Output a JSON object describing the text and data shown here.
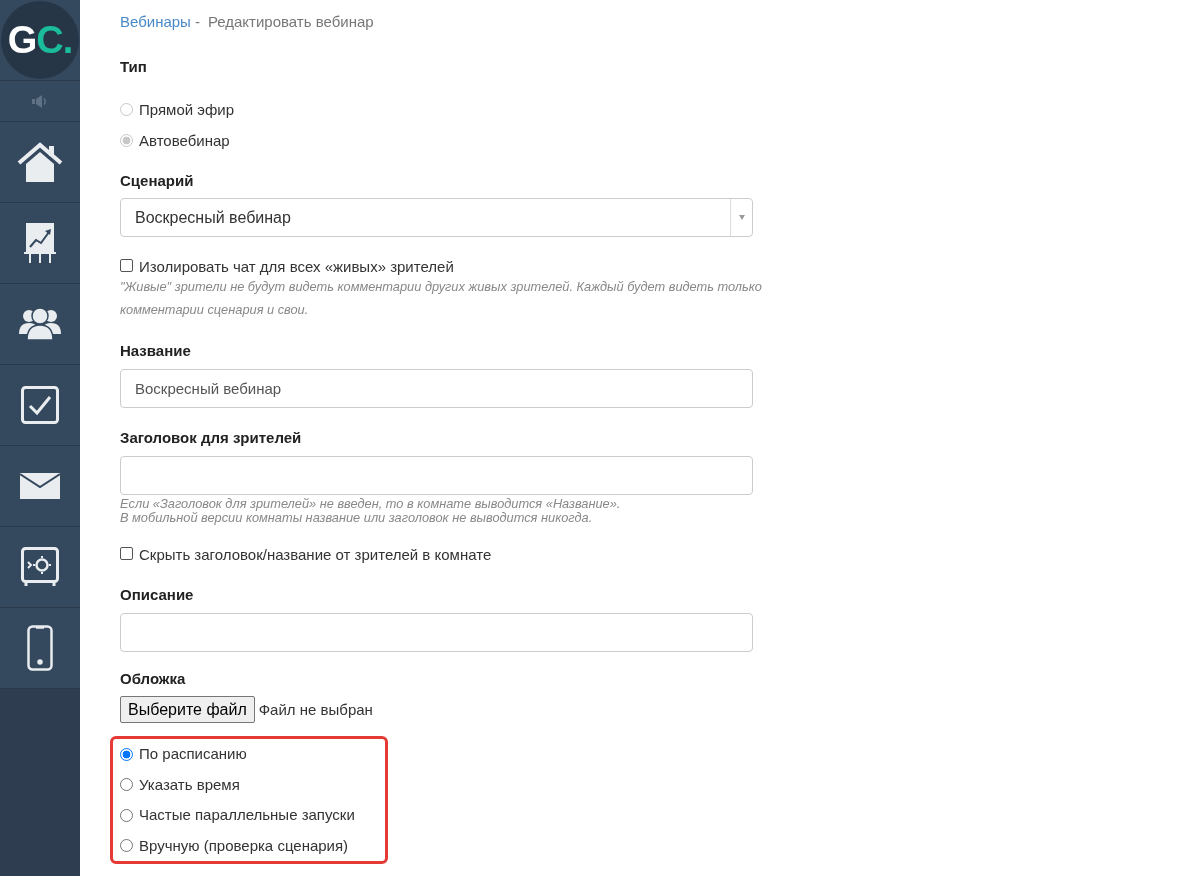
{
  "sidebar": {
    "logo": [
      {
        "text": "G",
        "color": "#ffffff"
      },
      {
        "text": "C.",
        "color": "#1abc9c"
      }
    ]
  },
  "breadcrumb": {
    "items": [
      {
        "label": "Вебинары",
        "kind": "link"
      },
      {
        "label": "Редактировать вебинар",
        "kind": "current"
      }
    ],
    "separator": "-"
  },
  "form": {
    "fields": [
      {
        "kind": "radio_group",
        "label": "Тип",
        "options": [
          {
            "label": "Прямой эфир",
            "selected": false,
            "disabled": true
          },
          {
            "label": "Автовебинар",
            "selected": true,
            "disabled": true
          }
        ]
      },
      {
        "kind": "select",
        "label": "Сценарий",
        "value": "Воскресный вебинар"
      },
      {
        "kind": "checkbox",
        "label": "Изолировать чат для всех «живых» зрителей",
        "checked": false,
        "hint_lines": [
          "\"Живые\" зрители не будут видеть комментарии других живых зрителей. Каждый будет видеть только",
          "комментарии сценария и свои."
        ]
      },
      {
        "kind": "text",
        "label": "Название",
        "value": "Воскресный вебинар"
      },
      {
        "kind": "text",
        "label": "Заголовок для зрителей",
        "hint_lines": [
          "Если «Заголовок для зрителей» не введен, то в комнате выводится «Название».",
          "В мобильной версии комнаты название или заголовок не выводится никогда."
        ]
      },
      {
        "kind": "checkbox",
        "label": "Скрыть заголовок/название от зрителей в комнате",
        "checked": false
      },
      {
        "kind": "text",
        "label": "Описание"
      },
      {
        "kind": "file",
        "label": "Обложка",
        "button": "Выберите файл",
        "status": "Файл не выбран"
      },
      {
        "kind": "radio_group",
        "highlighted": true,
        "options": [
          {
            "label": "По расписанию",
            "selected": true,
            "disabled": false
          },
          {
            "label": "Указать время",
            "selected": false,
            "disabled": false
          },
          {
            "label": "Частые параллельные запуски",
            "selected": false,
            "disabled": false
          },
          {
            "label": "Вручную (проверка сценария)",
            "selected": false,
            "disabled": false
          }
        ]
      }
    ]
  }
}
